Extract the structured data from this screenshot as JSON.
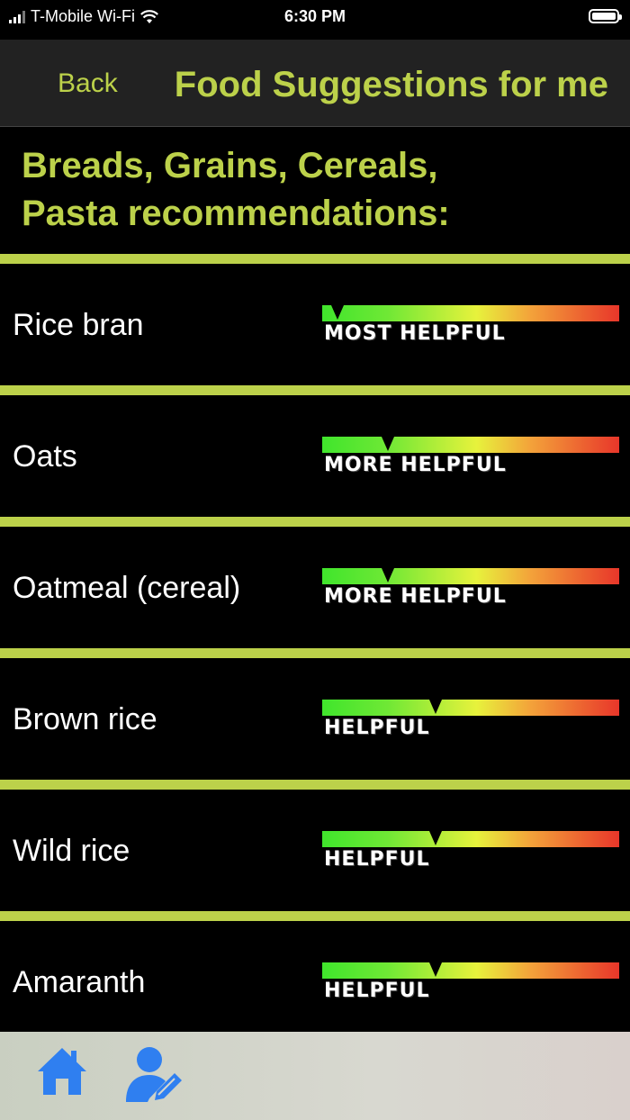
{
  "status_bar": {
    "carrier": "T-Mobile Wi-Fi",
    "time": "6:30 PM"
  },
  "nav": {
    "back_label": "Back",
    "title": "Food Suggestions for me"
  },
  "section": {
    "title_line1": "Breads, Grains, Cereals,",
    "title_line2": "Pasta recommendations:"
  },
  "foods": [
    {
      "name": "Rice bran",
      "rating": "MOST HELPFUL",
      "meter_position": 0.03
    },
    {
      "name": "Oats",
      "rating": "MORE HELPFUL",
      "meter_position": 0.2
    },
    {
      "name": "Oatmeal (cereal)",
      "rating": "MORE HELPFUL",
      "meter_position": 0.2
    },
    {
      "name": "Brown rice",
      "rating": "HELPFUL",
      "meter_position": 0.36
    },
    {
      "name": "Wild rice",
      "rating": "HELPFUL",
      "meter_position": 0.36
    },
    {
      "name": "Amaranth",
      "rating": "HELPFUL",
      "meter_position": 0.36
    }
  ],
  "tab_bar": {
    "items": [
      {
        "icon": "home-icon"
      },
      {
        "icon": "user-edit-icon"
      }
    ]
  },
  "colors": {
    "accent": "#bcd14a",
    "tab_icon": "#2f7ff0"
  }
}
